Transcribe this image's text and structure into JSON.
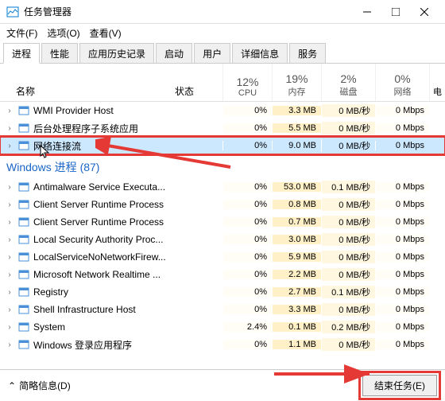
{
  "window": {
    "title": "任务管理器"
  },
  "menu": {
    "file": "文件(F)",
    "options": "选项(O)",
    "view": "查看(V)"
  },
  "tabs": [
    "进程",
    "性能",
    "应用历史记录",
    "启动",
    "用户",
    "详细信息",
    "服务"
  ],
  "columns": {
    "name": "名称",
    "status": "状态",
    "cpu": {
      "pct": "12%",
      "label": "CPU"
    },
    "mem": {
      "pct": "19%",
      "label": "内存"
    },
    "disk": {
      "pct": "2%",
      "label": "磁盘"
    },
    "net": {
      "pct": "0%",
      "label": "网络"
    },
    "last": "电"
  },
  "rows_top": [
    {
      "name": "WMI Provider Host",
      "cpu": "0%",
      "mem": "3.3 MB",
      "disk": "0 MB/秒",
      "net": "0 Mbps"
    },
    {
      "name": "后台处理程序子系统应用",
      "cpu": "0%",
      "mem": "5.5 MB",
      "disk": "0 MB/秒",
      "net": "0 Mbps"
    },
    {
      "name": "网络连接流",
      "cpu": "0%",
      "mem": "9.0 MB",
      "disk": "0 MB/秒",
      "net": "0 Mbps",
      "selected": true
    }
  ],
  "group": "Windows 进程 (87)",
  "rows_grp": [
    {
      "name": "Antimalware Service Executa...",
      "cpu": "0%",
      "mem": "53.0 MB",
      "disk": "0.1 MB/秒",
      "net": "0 Mbps"
    },
    {
      "name": "Client Server Runtime Process",
      "cpu": "0%",
      "mem": "0.8 MB",
      "disk": "0 MB/秒",
      "net": "0 Mbps"
    },
    {
      "name": "Client Server Runtime Process",
      "cpu": "0%",
      "mem": "0.7 MB",
      "disk": "0 MB/秒",
      "net": "0 Mbps"
    },
    {
      "name": "Local Security Authority Proc...",
      "cpu": "0%",
      "mem": "3.0 MB",
      "disk": "0 MB/秒",
      "net": "0 Mbps"
    },
    {
      "name": "LocalServiceNoNetworkFirew...",
      "cpu": "0%",
      "mem": "5.9 MB",
      "disk": "0 MB/秒",
      "net": "0 Mbps"
    },
    {
      "name": "Microsoft Network Realtime ...",
      "cpu": "0%",
      "mem": "2.2 MB",
      "disk": "0 MB/秒",
      "net": "0 Mbps"
    },
    {
      "name": "Registry",
      "cpu": "0%",
      "mem": "2.7 MB",
      "disk": "0.1 MB/秒",
      "net": "0 Mbps"
    },
    {
      "name": "Shell Infrastructure Host",
      "cpu": "0%",
      "mem": "3.3 MB",
      "disk": "0 MB/秒",
      "net": "0 Mbps"
    },
    {
      "name": "System",
      "cpu": "2.4%",
      "mem": "0.1 MB",
      "disk": "0.2 MB/秒",
      "net": "0 Mbps"
    },
    {
      "name": "Windows 登录应用程序",
      "cpu": "0%",
      "mem": "1.1 MB",
      "disk": "0 MB/秒",
      "net": "0 Mbps"
    }
  ],
  "footer": {
    "less": "简略信息(D)",
    "end": "结束任务(E)"
  }
}
